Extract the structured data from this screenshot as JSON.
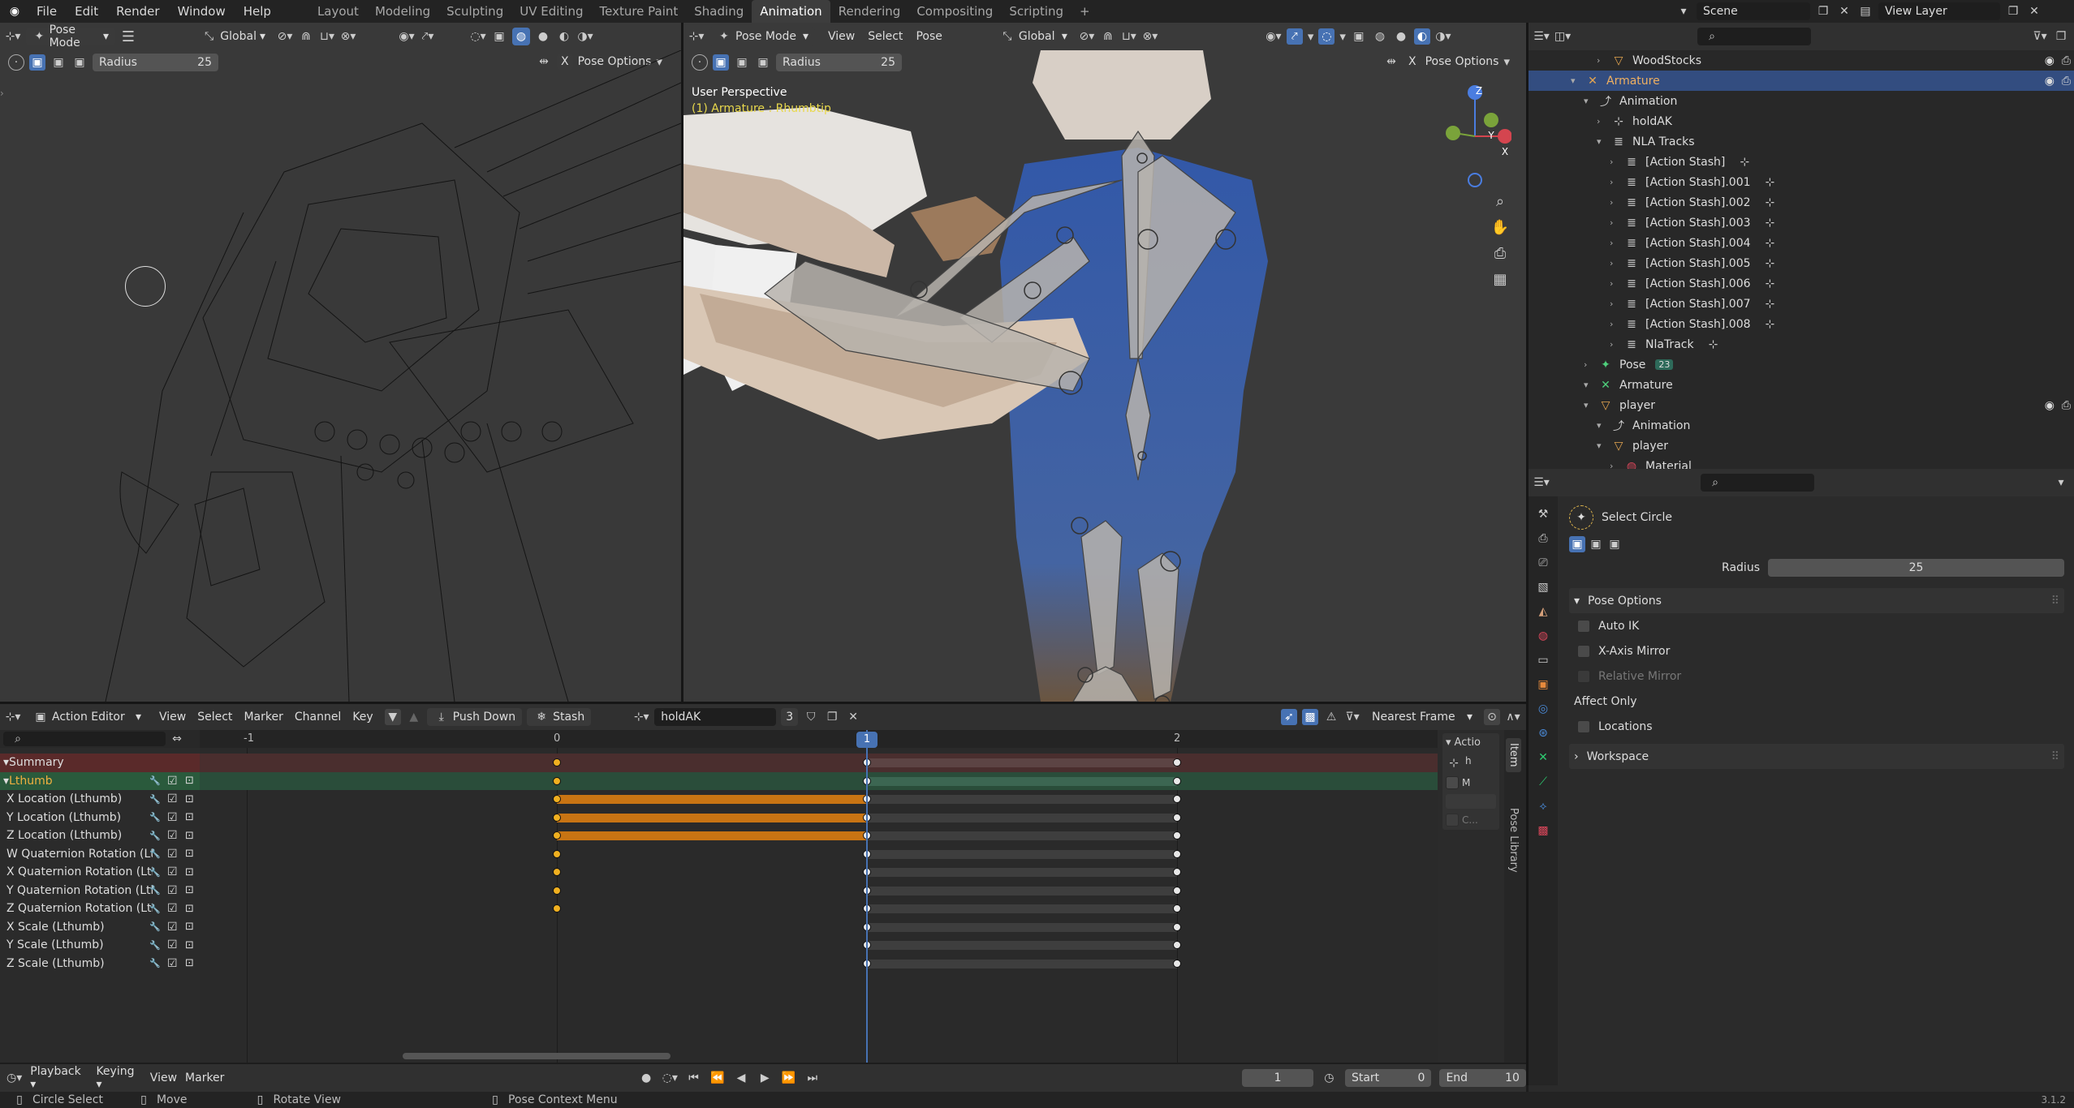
{
  "topbar": {
    "menus": [
      "File",
      "Edit",
      "Render",
      "Window",
      "Help"
    ],
    "workspaces": [
      "Layout",
      "Modeling",
      "Sculpting",
      "UV Editing",
      "Texture Paint",
      "Shading",
      "Animation",
      "Rendering",
      "Compositing",
      "Scripting"
    ],
    "active_workspace": "Animation",
    "add_tab": "+",
    "scene": "Scene",
    "view_layer": "View Layer"
  },
  "viewport_left": {
    "mode": "Pose Mode",
    "orientation": "Global",
    "radius_label": "Radius",
    "radius_value": "25",
    "pose_options": "Pose Options",
    "x_label": "X"
  },
  "viewport_right": {
    "mode": "Pose Mode",
    "menus": [
      "View",
      "Select",
      "Pose"
    ],
    "orientation": "Global",
    "radius_label": "Radius",
    "radius_value": "25",
    "pose_options": "Pose Options",
    "x_label": "X",
    "perspective": "User Perspective",
    "object_info": "(1) Armature : Rhumbtip",
    "gizmo": {
      "z": "Z",
      "y": "Y",
      "x": "X"
    }
  },
  "outliner": {
    "rows": [
      {
        "label": "WoodStocks",
        "indent": 4
      },
      {
        "label": "Armature",
        "indent": 2,
        "selected": true
      },
      {
        "label": "Animation",
        "indent": 3
      },
      {
        "label": "holdAK",
        "indent": 4
      },
      {
        "label": "NLA Tracks",
        "indent": 4
      },
      {
        "label": "[Action Stash]",
        "indent": 5
      },
      {
        "label": "[Action Stash].001",
        "indent": 5
      },
      {
        "label": "[Action Stash].002",
        "indent": 5
      },
      {
        "label": "[Action Stash].003",
        "indent": 5
      },
      {
        "label": "[Action Stash].004",
        "indent": 5
      },
      {
        "label": "[Action Stash].005",
        "indent": 5
      },
      {
        "label": "[Action Stash].006",
        "indent": 5
      },
      {
        "label": "[Action Stash].007",
        "indent": 5
      },
      {
        "label": "[Action Stash].008",
        "indent": 5
      },
      {
        "label": "NlaTrack",
        "indent": 5
      },
      {
        "label": "Pose",
        "indent": 3,
        "badge": "23"
      },
      {
        "label": "Armature",
        "indent": 3
      },
      {
        "label": "player",
        "indent": 3
      },
      {
        "label": "Animation",
        "indent": 4
      },
      {
        "label": "player",
        "indent": 4
      },
      {
        "label": "Material",
        "indent": 5
      }
    ]
  },
  "properties": {
    "tool_name": "Select Circle",
    "radius_label": "Radius",
    "radius_value": "25",
    "pose_options_title": "Pose Options",
    "auto_ik": "Auto IK",
    "x_axis_mirror": "X-Axis Mirror",
    "relative_mirror": "Relative Mirror",
    "affect_only": "Affect Only",
    "locations": "Locations",
    "workspace": "Workspace"
  },
  "action_editor": {
    "mode": "Action Editor",
    "menus": [
      "View",
      "Select",
      "Marker",
      "Channel",
      "Key"
    ],
    "push_down": "Push Down",
    "stash": "Stash",
    "action_name": "holdAK",
    "users": "3",
    "snap": "Nearest Frame",
    "frame_labels": [
      "-1",
      "0",
      "1",
      "2"
    ],
    "current_frame": "1",
    "channels": [
      {
        "label": "Summary",
        "type": "summary"
      },
      {
        "label": "Lthumb",
        "type": "group"
      },
      {
        "label": "X Location (Lthumb)",
        "type": "channel"
      },
      {
        "label": "Y Location (Lthumb)",
        "type": "channel"
      },
      {
        "label": "Z Location (Lthumb)",
        "type": "channel"
      },
      {
        "label": "W Quaternion Rotation (Lth",
        "type": "channel"
      },
      {
        "label": "X Quaternion Rotation (Lthu",
        "type": "channel"
      },
      {
        "label": "Y Quaternion Rotation (Lthu",
        "type": "channel"
      },
      {
        "label": "Z Quaternion Rotation (Lthu",
        "type": "channel"
      },
      {
        "label": "X Scale (Lthumb)",
        "type": "channel"
      },
      {
        "label": "Y Scale (Lthumb)",
        "type": "channel"
      },
      {
        "label": "Z Scale (Lthumb)",
        "type": "channel"
      }
    ],
    "side_tabs": [
      "Item",
      "Pose Library"
    ],
    "side_panel": {
      "title": "Actio",
      "h": "h",
      "m": "M",
      "c": "C..."
    }
  },
  "timeline": {
    "menus": [
      "Playback",
      "Keying",
      "View",
      "Marker"
    ],
    "frame": "1",
    "start_label": "Start",
    "start_value": "0",
    "end_label": "End",
    "end_value": "10"
  },
  "statusbar": {
    "items": [
      "Circle Select",
      "Move",
      "Rotate View",
      "Pose Context Menu"
    ],
    "version": "3.1.2"
  },
  "colors": {
    "accent": "#4772b3",
    "orange": "#c87413",
    "selected_row": "#334d80",
    "summary": "#5a2a2a",
    "group": "#2a5a3c"
  }
}
